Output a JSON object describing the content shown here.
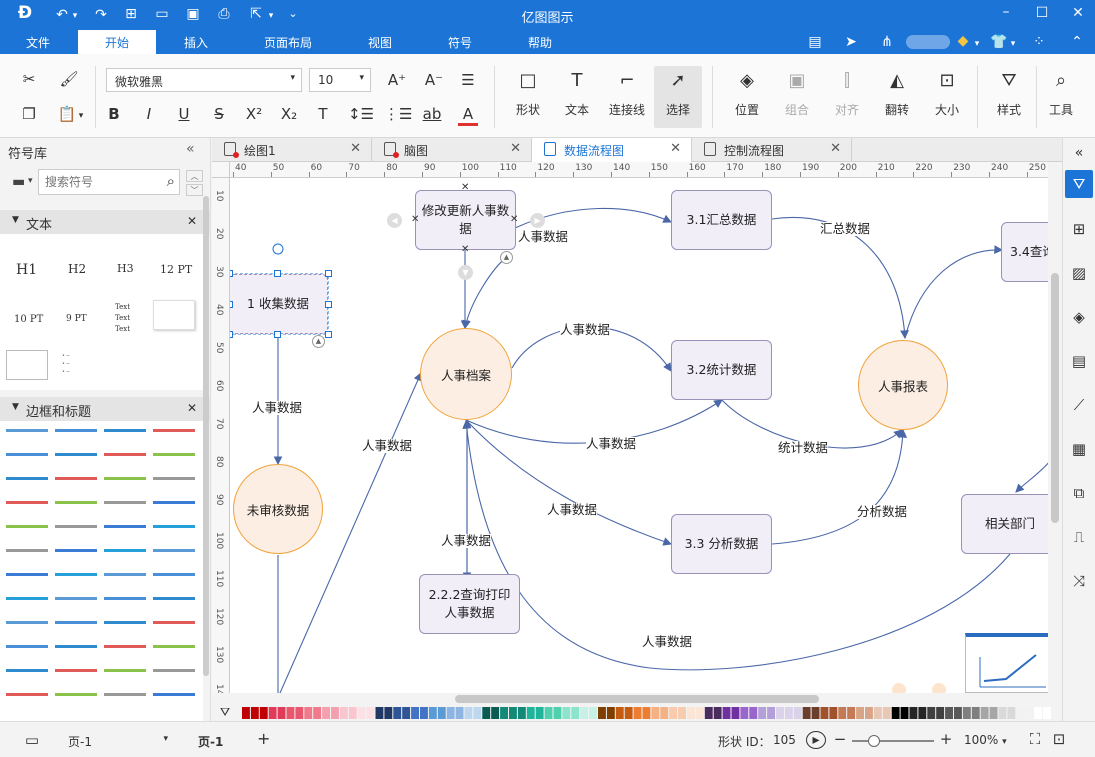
{
  "app_title": "亿图图示",
  "menu": [
    "文件",
    "开始",
    "插入",
    "页面布局",
    "视图",
    "符号",
    "帮助"
  ],
  "ribbon": {
    "font_name": "微软雅黑",
    "font_size": "10",
    "groups": [
      "形状",
      "文本",
      "连接线",
      "选择",
      "位置",
      "组合",
      "对齐",
      "翻转",
      "大小",
      "样式",
      "工具"
    ]
  },
  "left": {
    "title": "符号库",
    "search_placeholder": "搜索符号",
    "sections": [
      "文本",
      "边框和标题"
    ],
    "text_samples": [
      "H1",
      "H2",
      "H3",
      "12 PT",
      "10 PT",
      "9 PT"
    ],
    "text_stack": "Text"
  },
  "tabs": [
    "绘图1",
    "脑图",
    "数据流程图",
    "控制流程图"
  ],
  "ruler_top": [
    "40",
    "50",
    "60",
    "70",
    "80",
    "90",
    "100",
    "110",
    "120",
    "130",
    "140",
    "150",
    "160",
    "170",
    "180",
    "190",
    "200",
    "210",
    "220",
    "230",
    "240",
    "250"
  ],
  "ruler_left": [
    "10",
    "20",
    "30",
    "40",
    "50",
    "60",
    "70",
    "80",
    "90",
    "100",
    "110",
    "120",
    "130",
    "140"
  ],
  "diagram": {
    "procs": {
      "modify": "修改更新人事数据",
      "collect": "1 收集数据",
      "p31": "3.1汇总数据",
      "p32": "3.2统计数据",
      "p33": "3.3 分析数据",
      "p222": "2.2.2查询打印人事数据",
      "p34": "3.4查询",
      "dept": "相关部门"
    },
    "entities": {
      "archive": "人事档案",
      "unreviewed": "未审核数据",
      "report": "人事报表"
    },
    "edge_labels": {
      "hr": "人事数据",
      "sum": "汇总数据",
      "stat": "统计数据",
      "anal": "分析数据"
    }
  },
  "status": {
    "page_select": "页-1",
    "page_tab": "页-1",
    "add": "+",
    "shape_id_label": "形状 ID：",
    "shape_id": "105",
    "zoom": "100%"
  },
  "colors": {
    "accent": "#1b74d6",
    "entity_fill": "#fdeee3",
    "entity_border": "#f0a33c",
    "process_fill": "#f1eef8",
    "edge": "#4a67a8"
  }
}
